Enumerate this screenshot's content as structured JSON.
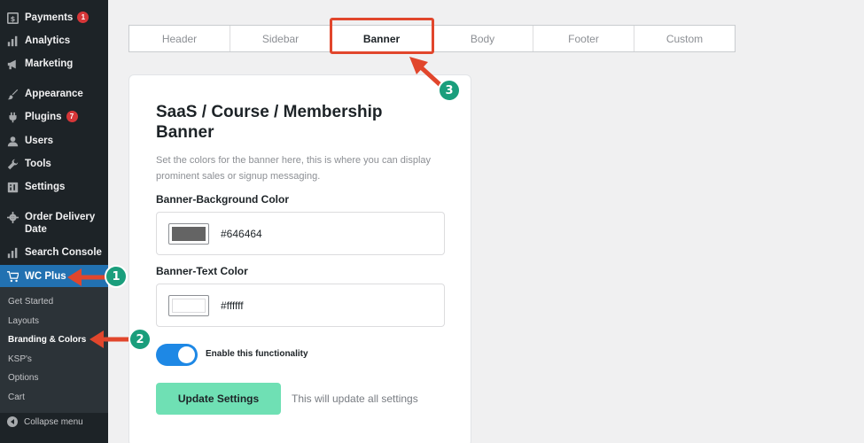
{
  "sidebar": {
    "items": [
      {
        "label": "Payments",
        "icon": "payments-icon",
        "badge": "1"
      },
      {
        "label": "Analytics",
        "icon": "analytics-icon"
      },
      {
        "label": "Marketing",
        "icon": "megaphone-icon"
      },
      {
        "label": "Appearance",
        "icon": "paintbrush-icon"
      },
      {
        "label": "Plugins",
        "icon": "plugin-icon",
        "badge": "7"
      },
      {
        "label": "Users",
        "icon": "user-icon"
      },
      {
        "label": "Tools",
        "icon": "wrench-icon"
      },
      {
        "label": "Settings",
        "icon": "settings-icon"
      },
      {
        "label": "Order Delivery Date",
        "icon": "gear-icon"
      },
      {
        "label": "Search Console",
        "icon": "analytics-icon"
      },
      {
        "label": "WC Plus",
        "icon": "cart-icon"
      }
    ],
    "submenu": [
      "Get Started",
      "Layouts",
      "Branding & Colors",
      "KSP's",
      "Options",
      "Cart"
    ],
    "collapse_label": "Collapse menu"
  },
  "tabs": [
    "Header",
    "Sidebar",
    "Banner",
    "Body",
    "Footer",
    "Custom"
  ],
  "active_tab": "Banner",
  "card": {
    "title": "SaaS / Course / Membership Banner",
    "description": "Set the colors for the banner here, this is where you can display prominent sales or signup messaging.",
    "bg_label": "Banner-Background Color",
    "bg_value": "#646464",
    "text_label": "Banner-Text Color",
    "text_value": "#ffffff",
    "toggle_label": "Enable this functionality",
    "toggle_on": true,
    "update_button": "Update Settings",
    "update_note": "This will update all settings"
  },
  "annotations": [
    "1",
    "2",
    "3"
  ],
  "colors": {
    "sidebar_bg": "#1d2327",
    "active_menu": "#2271b1",
    "annotation_red": "#e1462c",
    "annotation_green": "#1a9e7c",
    "update_button": "#6fe0b4",
    "toggle": "#1e88e5"
  }
}
